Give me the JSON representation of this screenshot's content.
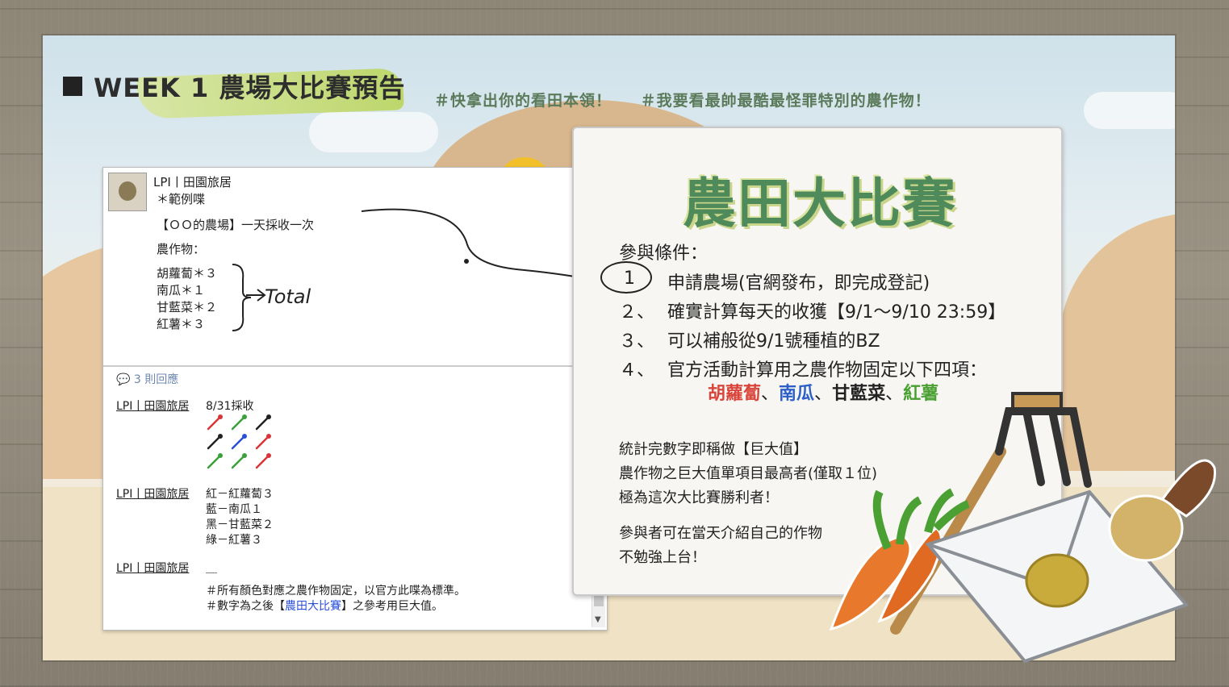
{
  "header": {
    "title": "WEEK 1 農場大比賽預告",
    "hashtags": [
      "＃快拿出你的看田本領！",
      "＃我要看最帥最酷最怪罪特別的農作物！"
    ]
  },
  "post": {
    "author": "LPI丨田園旅居",
    "sample_label": "＊範例喋",
    "farm_line": "【ＯＯ的農場】一天採收一次",
    "crops_label": "農作物：",
    "crops": [
      "胡蘿蔔＊３",
      "南瓜＊１",
      "甘藍菜＊２",
      "紅薯＊３"
    ],
    "total_note": "Total",
    "comment_count": "3 則回應",
    "comments": [
      {
        "author": "LPI丨田園旅居",
        "text": "8/31採收"
      },
      {
        "author": "LPI丨田園旅居",
        "lines": [
          "紅－紅蘿蔔３",
          "藍－南瓜１",
          "黑－甘藍菜２",
          "綠－紅薯３"
        ]
      },
      {
        "author": "LPI丨田園旅居",
        "text": "＿",
        "notes": [
          "＃所有顏色對應之農作物固定，以官方此喋為標準。",
          "＃數字為之後【",
          "農田大比賽",
          "】之參考用巨大值。"
        ]
      }
    ]
  },
  "card": {
    "title": "農田大比賽",
    "conditions_label": "參與條件：",
    "items": [
      {
        "num": "1",
        "text": "申請農場(官網發布，即完成登記)"
      },
      {
        "num": "２、",
        "text": "確實計算每天的收獲【9/1～9/10 23:59】"
      },
      {
        "num": "３、",
        "text": "可以補般從9/1號種植的BZ"
      },
      {
        "num": "４、",
        "text": "官方活動計算用之農作物固定以下四項："
      }
    ],
    "crop_list": [
      {
        "name": "胡蘿蔔",
        "color": "#d9453a"
      },
      {
        "name": "南瓜",
        "color": "#2c5fc8"
      },
      {
        "name": "甘藍菜",
        "color": "#222222"
      },
      {
        "name": "紅薯",
        "color": "#4aa032"
      }
    ],
    "separator": "、",
    "rules": [
      "統計完數字即稱做【巨大值】",
      "農作物之巨大值單項目最高者(僅取１位)",
      "極為這次大比賽勝利者！"
    ],
    "notes": [
      "參與者可在當天介紹自己的作物",
      "不勉強上台！"
    ]
  }
}
